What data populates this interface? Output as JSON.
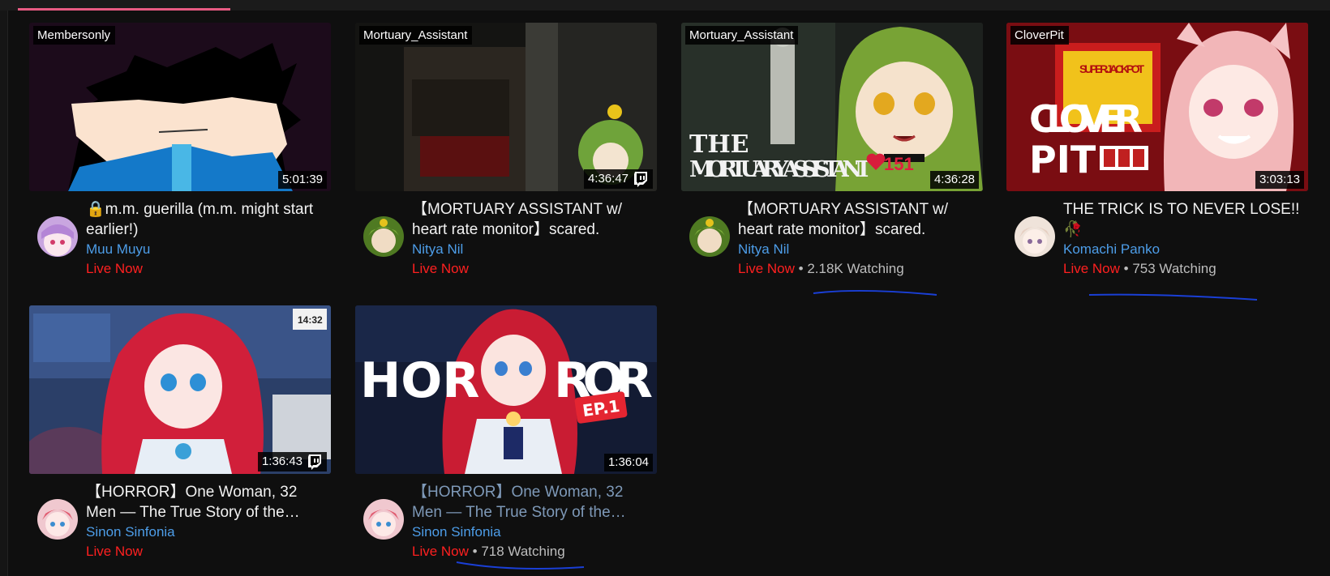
{
  "cards": [
    {
      "tag": "Membersonly",
      "duration": "5:01:39",
      "title": "🔒m.m. guerilla (m.m. might start earlier!)",
      "channel": "Muu Muyu",
      "live": "Live Now",
      "watching": ""
    },
    {
      "tag": "Mortuary_Assistant",
      "duration": "4:36:47",
      "title": "【MORTUARY ASSISTANT w/ heart rate monitor】scared.",
      "channel": "Nitya Nil",
      "live": "Live Now",
      "watching": ""
    },
    {
      "tag": "Mortuary_Assistant",
      "duration": "4:36:28",
      "title": "【MORTUARY ASSISTANT w/ heart rate monitor】scared.",
      "channel": "Nitya Nil",
      "live": "Live Now",
      "watching": "2.18K Watching"
    },
    {
      "tag": "CloverPit",
      "duration": "3:03:13",
      "title": "THE TRICK IS TO NEVER LOSE!! 🥀",
      "channel": "Komachi Panko",
      "live": "Live Now",
      "watching": "753 Watching"
    },
    {
      "tag": "",
      "duration": "1:36:43",
      "title": "【HORROR】One Woman, 32 Men — The True Story of the…",
      "channel": "Sinon Sinfonia",
      "live": "Live Now",
      "watching": ""
    },
    {
      "tag": "",
      "duration": "1:36:04",
      "title": "【HORROR】One Woman, 32 Men — The True Story of the…",
      "channel": "Sinon Sinfonia",
      "live": "Live Now",
      "watching": "718 Watching"
    }
  ],
  "thumb_text": {
    "mortuary_line1": "THE",
    "mortuary_line2": "MORTUARY ASSISTANT",
    "heart_count": "151",
    "clover_line1": "CLOVER",
    "clover_line2": "PIT",
    "jackpot": "SUPER JACKPOT",
    "clock_time": "14:32",
    "horror_left": "HOR",
    "horror_right": "ROR",
    "ep_badge": "EP.1"
  },
  "separator": " • ",
  "colors": {
    "live": "#ff2020",
    "channel": "#4d9de8",
    "accent": "#e85b83",
    "annotation": "#1a3fd6"
  }
}
